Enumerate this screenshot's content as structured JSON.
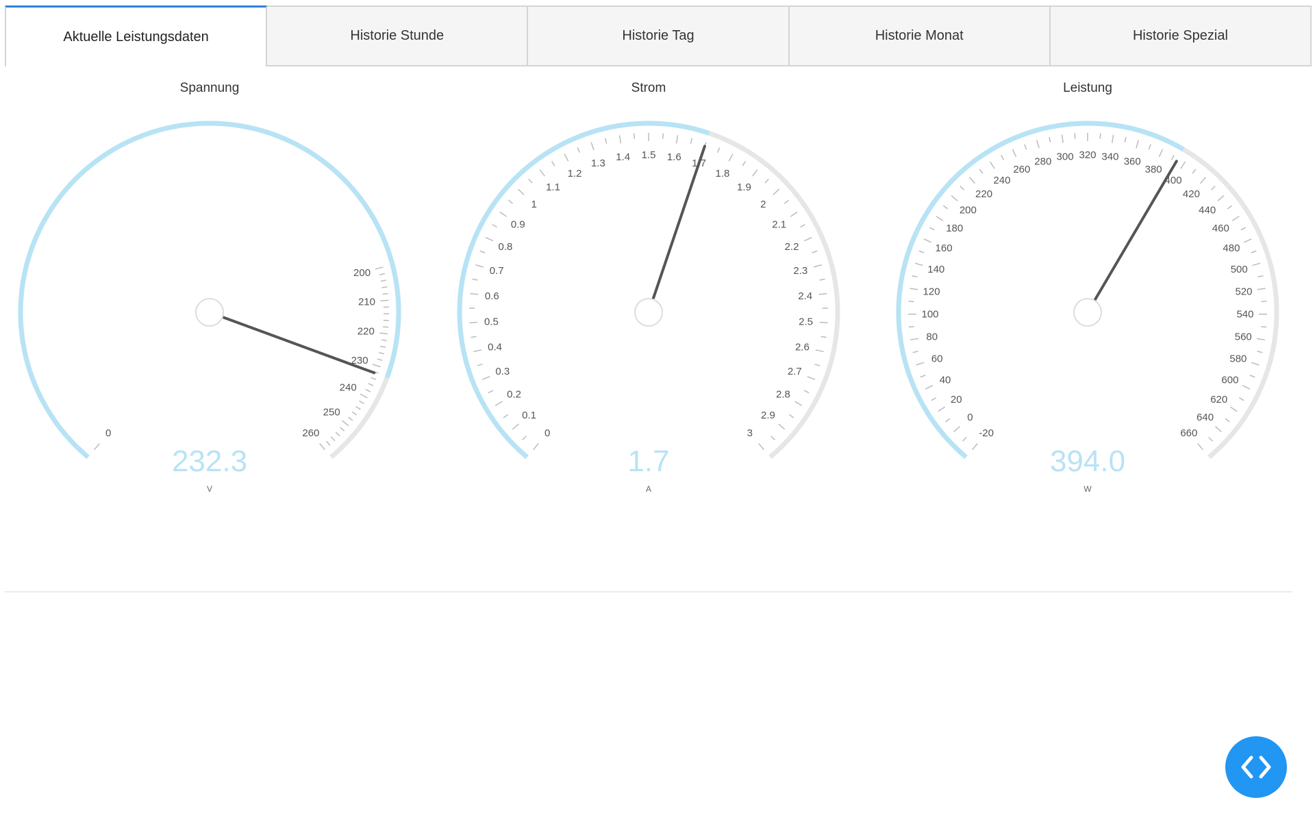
{
  "tabs": [
    {
      "label": "Aktuelle Leistungsdaten",
      "active": true
    },
    {
      "label": "Historie Stunde",
      "active": false
    },
    {
      "label": "Historie Tag",
      "active": false
    },
    {
      "label": "Historie Monat",
      "active": false
    },
    {
      "label": "Historie Spezial",
      "active": false
    }
  ],
  "colors": {
    "accent_tab": "#2f7fd8",
    "gauge_fill": "#b7e3f5",
    "gauge_track": "#e6e6e6",
    "value_text": "#b7e3f5",
    "needle": "#555555",
    "code_button": "#2196f3"
  },
  "gauges": [
    {
      "title": "Spannung",
      "value": 232.3,
      "value_text": "232.3",
      "unit": "V",
      "scale_min": 0,
      "scale_max": 260,
      "tick_labels": [
        "0",
        "200",
        "210",
        "220",
        "230",
        "240",
        "250",
        "260"
      ]
    },
    {
      "title": "Strom",
      "value": 1.7,
      "value_text": "1.7",
      "unit": "A",
      "scale_min": 0,
      "scale_max": 3,
      "tick_labels": [
        "0",
        "0.1",
        "0.2",
        "0.3",
        "0.4",
        "0.5",
        "0.6",
        "0.7",
        "0.8",
        "0.9",
        "1",
        "1.1",
        "1.2",
        "1.3",
        "1.4",
        "1.5",
        "1.6",
        "1.7",
        "1.8",
        "1.9",
        "2",
        "2.1",
        "2.2",
        "2.3",
        "2.4",
        "2.5",
        "2.6",
        "2.7",
        "2.8",
        "2.9",
        "3"
      ]
    },
    {
      "title": "Leistung",
      "value": 394.0,
      "value_text": "394.0",
      "unit": "W",
      "scale_min": -20,
      "scale_max": 660,
      "tick_labels": [
        "-20",
        "0",
        "20",
        "40",
        "60",
        "80",
        "100",
        "120",
        "140",
        "160",
        "180",
        "200",
        "220",
        "240",
        "260",
        "280",
        "300",
        "320",
        "340",
        "360",
        "380",
        "400",
        "420",
        "440",
        "460",
        "480",
        "500",
        "520",
        "540",
        "560",
        "580",
        "600",
        "620",
        "640",
        "660"
      ]
    }
  ],
  "fab": {
    "icon": "code-brackets-icon"
  }
}
